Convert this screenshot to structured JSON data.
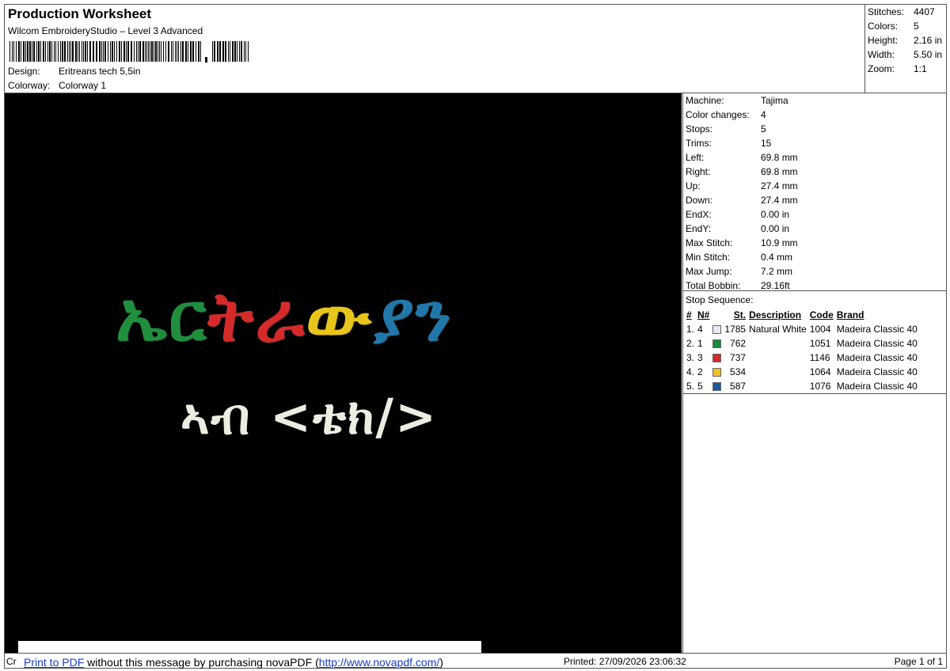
{
  "header": {
    "title": "Production Worksheet",
    "subtitle": "Wilcom EmbroideryStudio – Level 3 Advanced",
    "barcode_label": "barcode",
    "design_label": "Design:",
    "design_value": "Eritreans tech 5,5in",
    "colorway_label": "Colorway:",
    "colorway_value": "Colorway 1"
  },
  "summary": {
    "stitches_label": "Stitches:",
    "stitches_value": "4407",
    "colors_label": "Colors:",
    "colors_value": "5",
    "height_label": "Height:",
    "height_value": "2.16 in",
    "width_label": "Width:",
    "width_value": "5.50 in",
    "zoom_label": "Zoom:",
    "zoom_value": "1:1"
  },
  "preview": {
    "line1": [
      {
        "text": "ኤ",
        "color": "#1f8f3e"
      },
      {
        "text": "ር",
        "color": "#1f8f3e"
      },
      {
        "text": "ት",
        "color": "#d62a2a"
      },
      {
        "text": "ራ",
        "color": "#d62a2a"
      },
      {
        "text": "ው",
        "color": "#e8c51a"
      },
      {
        "text": "ያ",
        "color": "#2277aa"
      },
      {
        "text": "ን",
        "color": "#2277aa"
      }
    ],
    "line2": "ኣብ <ቴክ/>",
    "line2_color": "#ecece2",
    "background": "#000000"
  },
  "machine": {
    "machine_label": "Machine:",
    "machine_value": "Tajima",
    "color_changes_label": "Color changes:",
    "color_changes_value": "4",
    "stops_label": "Stops:",
    "stops_value": "5",
    "trims_label": "Trims:",
    "trims_value": "15",
    "left_label": "Left:",
    "left_value": "69.8 mm",
    "right_label": "Right:",
    "right_value": "69.8 mm",
    "up_label": "Up:",
    "up_value": "27.4 mm",
    "down_label": "Down:",
    "down_value": "27.4 mm",
    "endx_label": "EndX:",
    "endx_value": "0.00 in",
    "endy_label": "EndY:",
    "endy_value": "0.00 in",
    "max_stitch_label": "Max Stitch:",
    "max_stitch_value": "10.9 mm",
    "min_stitch_label": "Min Stitch:",
    "min_stitch_value": "0.4 mm",
    "max_jump_label": "Max Jump:",
    "max_jump_value": "7.2 mm",
    "total_bobbin_label": "Total Bobbin:",
    "total_bobbin_value": "29.16ft"
  },
  "stop_sequence": {
    "title": "Stop Sequence:",
    "columns": [
      "#",
      "N#",
      "St.",
      "Description",
      "Code",
      "Brand"
    ],
    "rows": [
      {
        "num": "1.",
        "n": "4",
        "color": "#e8e8f0",
        "st": "1785",
        "desc": "Natural White",
        "code": "1004",
        "brand": "Madeira Classic 40"
      },
      {
        "num": "2.",
        "n": "1",
        "color": "#1a8a3a",
        "st": "762",
        "desc": "",
        "code": "1051",
        "brand": "Madeira Classic 40"
      },
      {
        "num": "3.",
        "n": "3",
        "color": "#d42a2a",
        "st": "737",
        "desc": "",
        "code": "1146",
        "brand": "Madeira Classic 40"
      },
      {
        "num": "4.",
        "n": "2",
        "color": "#f0c020",
        "st": "534",
        "desc": "",
        "code": "1064",
        "brand": "Madeira Classic 40"
      },
      {
        "num": "5.",
        "n": "5",
        "color": "#1a5a9a",
        "st": "587",
        "desc": "",
        "code": "1076",
        "brand": "Madeira Classic 40"
      }
    ]
  },
  "footer": {
    "cr": "Cr",
    "pdf_link": "Print to PDF",
    "pdf_msg": " without this message by purchasing novaPDF (",
    "pdf_url": "http://www.novapdf.com/",
    "pdf_close": ")",
    "printed": "Printed: 27/09/2026 23:06:32",
    "page": "Page 1 of 1"
  }
}
